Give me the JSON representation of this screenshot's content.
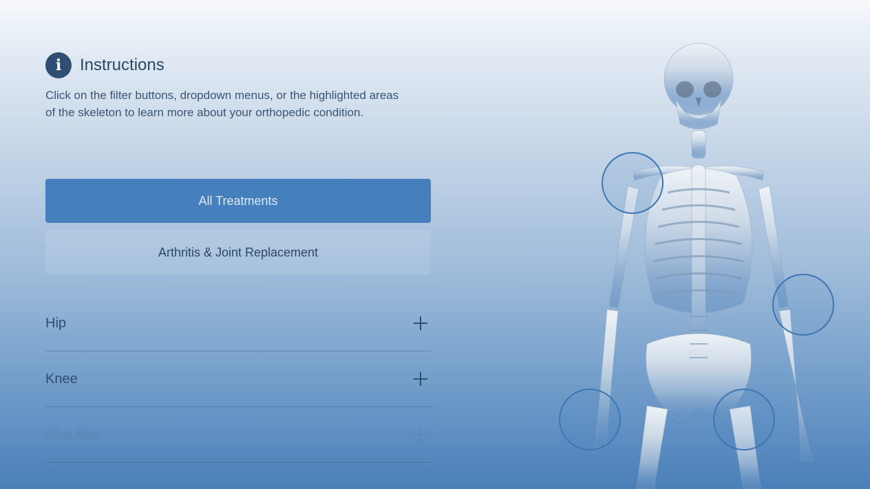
{
  "instructions": {
    "title": "Instructions",
    "text": "Click on the filter buttons, dropdown menus, or the highlighted areas of the skeleton to learn more about your orthopedic condition.",
    "icon": "info-icon"
  },
  "filters": {
    "primary_label": "All Treatments",
    "secondary_label": "Arthritis & Joint Replacement",
    "active": "All Treatments"
  },
  "accordion": [
    {
      "label": "Hip"
    },
    {
      "label": "Knee"
    },
    {
      "label": "Shoulder"
    }
  ],
  "colors": {
    "accent": "#4580bd",
    "text": "#2f4f72",
    "hotspot": "#3d76b5"
  }
}
